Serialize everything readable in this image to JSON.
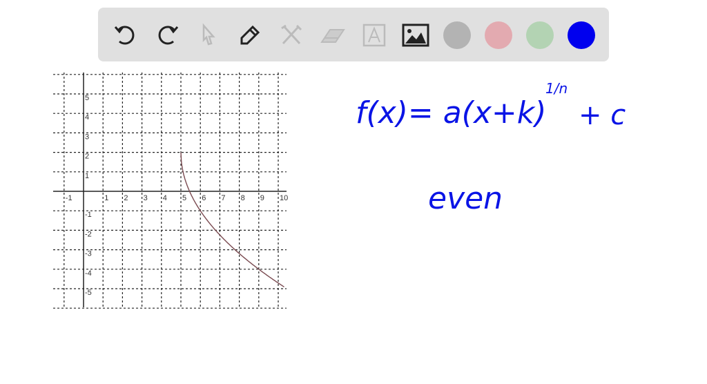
{
  "toolbar": {
    "tools": [
      "undo",
      "redo",
      "select",
      "pen",
      "tools",
      "eraser",
      "text",
      "image"
    ],
    "colors": {
      "gray": "#b3b3b3",
      "pink": "#e3aab0",
      "green": "#b3d3b3",
      "blue": "#0000ee"
    }
  },
  "chart_data": {
    "type": "line",
    "title": "",
    "xlabel": "",
    "ylabel": "",
    "xlim": [
      -1.5,
      10.3
    ],
    "ylim": [
      -6,
      6
    ],
    "x_ticks": [
      "-1",
      "1",
      "2",
      "3",
      "4",
      "5",
      "6",
      "7",
      "8",
      "9",
      "10"
    ],
    "y_ticks": [
      "5",
      "4",
      "3",
      "2",
      "1",
      "-1",
      "-2",
      "-3",
      "-4",
      "-5"
    ],
    "grid": true,
    "series": [
      {
        "name": "f(x)",
        "color": "#7a4a50",
        "x": [
          5,
          5.05,
          5.2,
          5.5,
          6,
          6.5,
          7,
          7.5,
          8,
          8.5,
          9,
          9.5,
          10.3
        ],
        "y": [
          2,
          1.33,
          0.66,
          -0.12,
          -1,
          -1.67,
          -2.24,
          -2.74,
          -3.2,
          -3.61,
          -4,
          -4.36,
          -4.9
        ]
      }
    ]
  },
  "notes": {
    "formula_main": "f(x)= a(x+k)",
    "formula_exp": "1/n",
    "formula_tail": "+ c",
    "word": "even"
  }
}
